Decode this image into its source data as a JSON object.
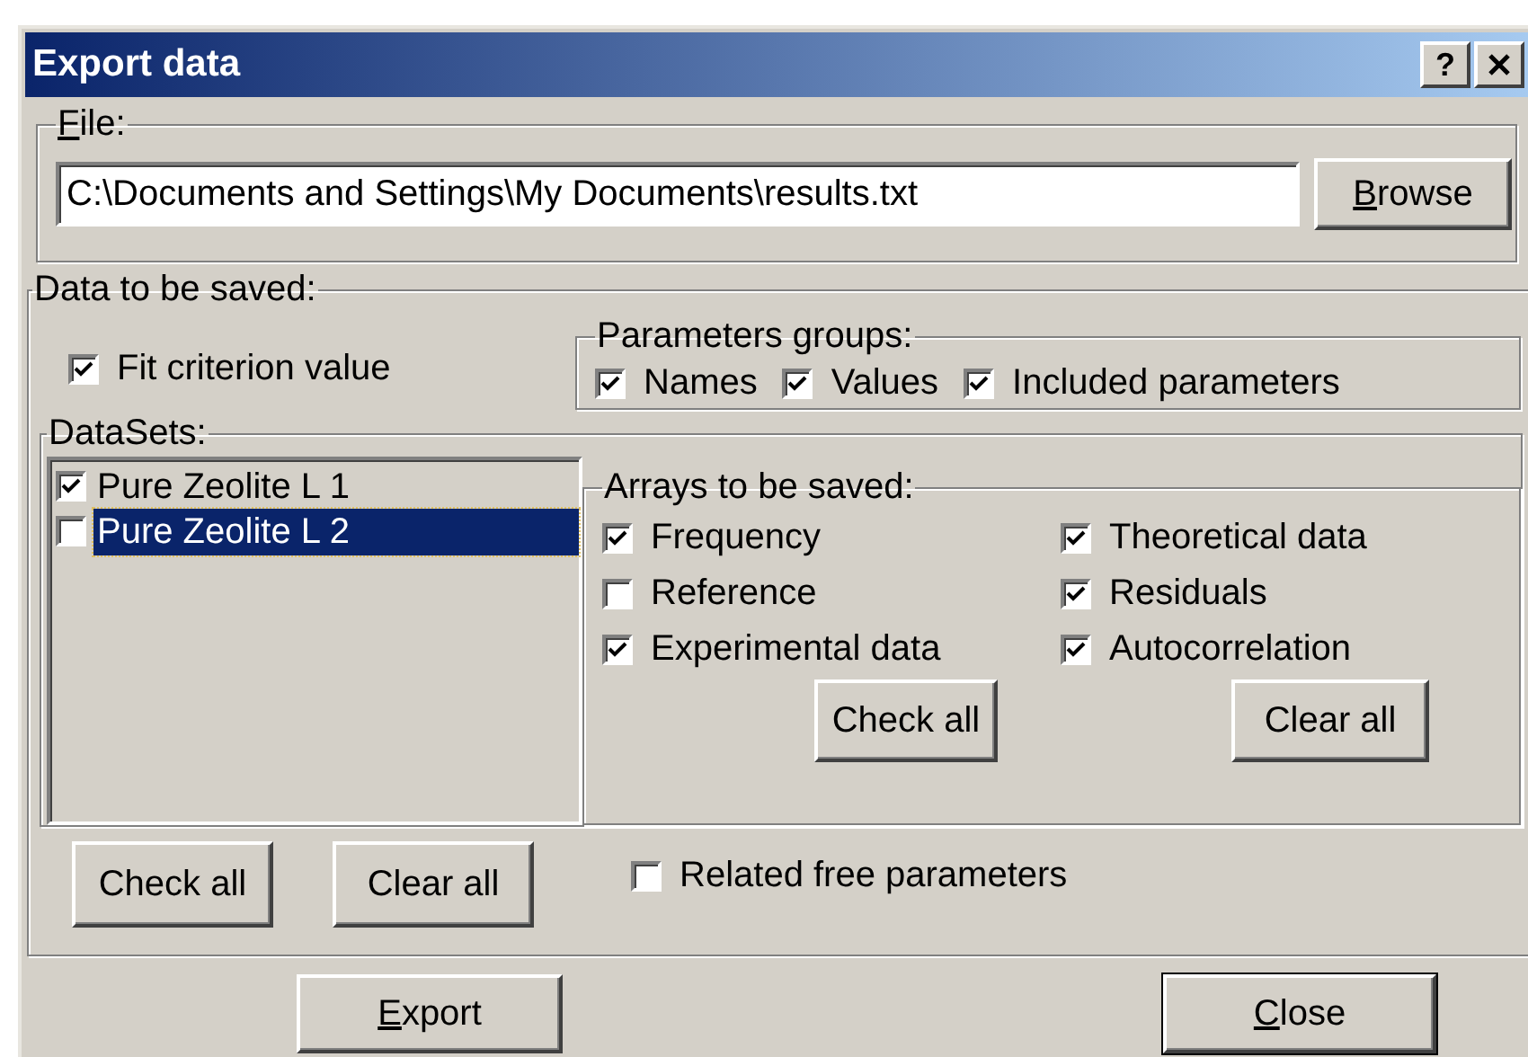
{
  "window": {
    "title": "Export data",
    "help_button": "?"
  },
  "file_group": {
    "accel": "F",
    "label": "ile:",
    "path": "C:\\Documents and Settings\\My Documents\\results.txt",
    "browse": {
      "accel": "B",
      "label": "rowse"
    }
  },
  "data_group": {
    "label": "Data to be saved:",
    "fit_criterion": {
      "label": "Fit criterion value",
      "checked": true
    },
    "parameters_groups": {
      "label": "Parameters groups:",
      "items": [
        {
          "label": "Names",
          "checked": true
        },
        {
          "label": "Values",
          "checked": true
        },
        {
          "label": "Included parameters",
          "checked": true
        }
      ]
    },
    "datasets": {
      "label": "DataSets:",
      "items": [
        {
          "name": "Pure Zeolite L 1",
          "checked": true,
          "selected": false
        },
        {
          "name": "Pure Zeolite L 2",
          "checked": false,
          "selected": true
        }
      ]
    },
    "arrays": {
      "label": "Arrays to be saved:",
      "items": [
        {
          "label": "Frequency",
          "checked": true
        },
        {
          "label": "Theoretical data",
          "checked": true
        },
        {
          "label": "Reference",
          "checked": false
        },
        {
          "label": "Residuals",
          "checked": true
        },
        {
          "label": "Experimental data",
          "checked": true
        },
        {
          "label": "Autocorrelation",
          "checked": true
        }
      ],
      "check_all": "Check all",
      "clear_all": "Clear all"
    },
    "check_all": "Check all",
    "clear_all": "Clear all",
    "related_free_parameters": {
      "label": "Related free parameters",
      "checked": false
    }
  },
  "buttons": [
    {
      "accel": "E",
      "label": "xport",
      "default": false
    },
    {
      "accel": "C",
      "label": "lose",
      "default": true
    }
  ]
}
